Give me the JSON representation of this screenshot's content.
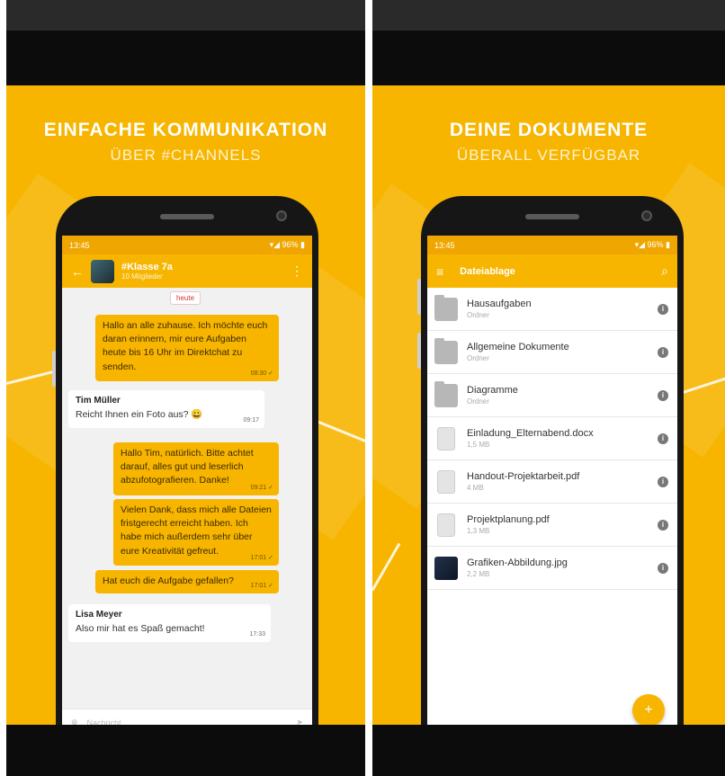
{
  "colors": {
    "accent": "#f7b500",
    "dark": "#0c0c0c",
    "status_bar": "#f0a600"
  },
  "left": {
    "headline": "EINFACHE KOMMUNIKATION",
    "subline": "ÜBER #CHANNELS",
    "status_time": "13:45",
    "status_icons": "▾◢ 96% ▮",
    "channel_title": "#Klasse 7a",
    "channel_sub": "10 Mitglieder",
    "date_chip": "heute",
    "messages": [
      {
        "text": "Hallo an alle zuhause. Ich möchte euch daran erinnern, mir eure Aufgaben heute bis 16 Uhr im Direktchat zu senden.",
        "time": "08:30 ✓"
      },
      {
        "sender": "Tim Müller",
        "text": "Reicht Ihnen ein Foto aus? 😀",
        "time": "09:17"
      },
      {
        "text": "Hallo Tim, natürlich. Bitte achtet darauf, alles gut und leserlich abzufotografieren. Danke!",
        "time": "09:21 ✓"
      },
      {
        "text": "Vielen Dank, dass mich alle Dateien fristgerecht erreicht haben. Ich habe mich außerdem sehr über eure Kreativität gefreut.",
        "time": "17:01 ✓"
      },
      {
        "text": "Hat euch die Aufgabe gefallen?",
        "time": "17:01 ✓"
      },
      {
        "sender": "Lisa Meyer",
        "text": "Also mir hat es Spaß gemacht!",
        "time": "17:33"
      }
    ],
    "composer_placeholder": "Nachricht",
    "icons": {
      "back": "arrow-left-icon",
      "more": "more-vert-icon",
      "attach": "attach-icon",
      "send": "send-icon"
    }
  },
  "right": {
    "headline": "DEINE DOKUMENTE",
    "subline": "ÜBERALL VERFÜGBAR",
    "status_time": "13:45",
    "status_icons": "▾◢ 96% ▮",
    "screen_title": "Dateiablage",
    "files": [
      {
        "name": "Hausaufgaben",
        "meta": "Ordner",
        "icon": "folder-icon"
      },
      {
        "name": "Allgemeine Dokumente",
        "meta": "Ordner",
        "icon": "folder-icon"
      },
      {
        "name": "Diagramme",
        "meta": "Ordner",
        "icon": "folder-icon"
      },
      {
        "name": "Einladung_Elternabend.docx",
        "meta": "1,5 MB",
        "icon": "document-icon"
      },
      {
        "name": "Handout-Projektarbeit.pdf",
        "meta": "4 MB",
        "icon": "pdf-icon"
      },
      {
        "name": "Projektplanung.pdf",
        "meta": "1,3 MB",
        "icon": "pdf-icon"
      },
      {
        "name": "Grafiken-Abbildung.jpg",
        "meta": "2,2 MB",
        "icon": "image-icon"
      }
    ],
    "info_glyph": "i",
    "fab_glyph": "+",
    "icons": {
      "menu": "menu-icon",
      "search": "search-icon",
      "info": "info-icon",
      "add": "add-icon"
    }
  }
}
